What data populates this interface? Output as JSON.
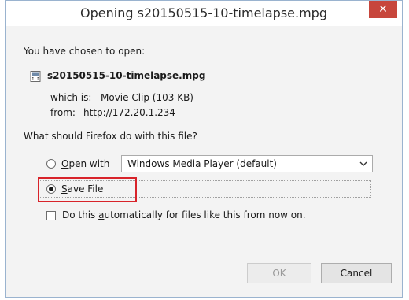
{
  "window": {
    "title": "Opening s20150515-10-timelapse.mpg",
    "close_glyph": "✕"
  },
  "info": {
    "intro": "You have chosen to open:",
    "filename": "s20150515-10-timelapse.mpg",
    "file_icon": "video-file-icon",
    "which_is_label": "which is:",
    "which_is_value": "Movie Clip (103 KB)",
    "from_label": "from:",
    "from_value": "http://172.20.1.234"
  },
  "action": {
    "question": "What should Firefox do with this file?",
    "open_with_label_accel": "O",
    "open_with_label_rest": "pen with",
    "open_with_selected": false,
    "app_select_value": "Windows Media Player (default)",
    "save_file_label_accel": "S",
    "save_file_label_rest": "ave File",
    "save_file_selected": true,
    "auto_label_pre": "Do this ",
    "auto_label_accel": "a",
    "auto_label_post": "utomatically for files like this from now on.",
    "auto_checked": false
  },
  "buttons": {
    "ok": "OK",
    "cancel": "Cancel"
  },
  "colors": {
    "close_button": "#c7463c",
    "highlight_box": "#d8232a"
  }
}
